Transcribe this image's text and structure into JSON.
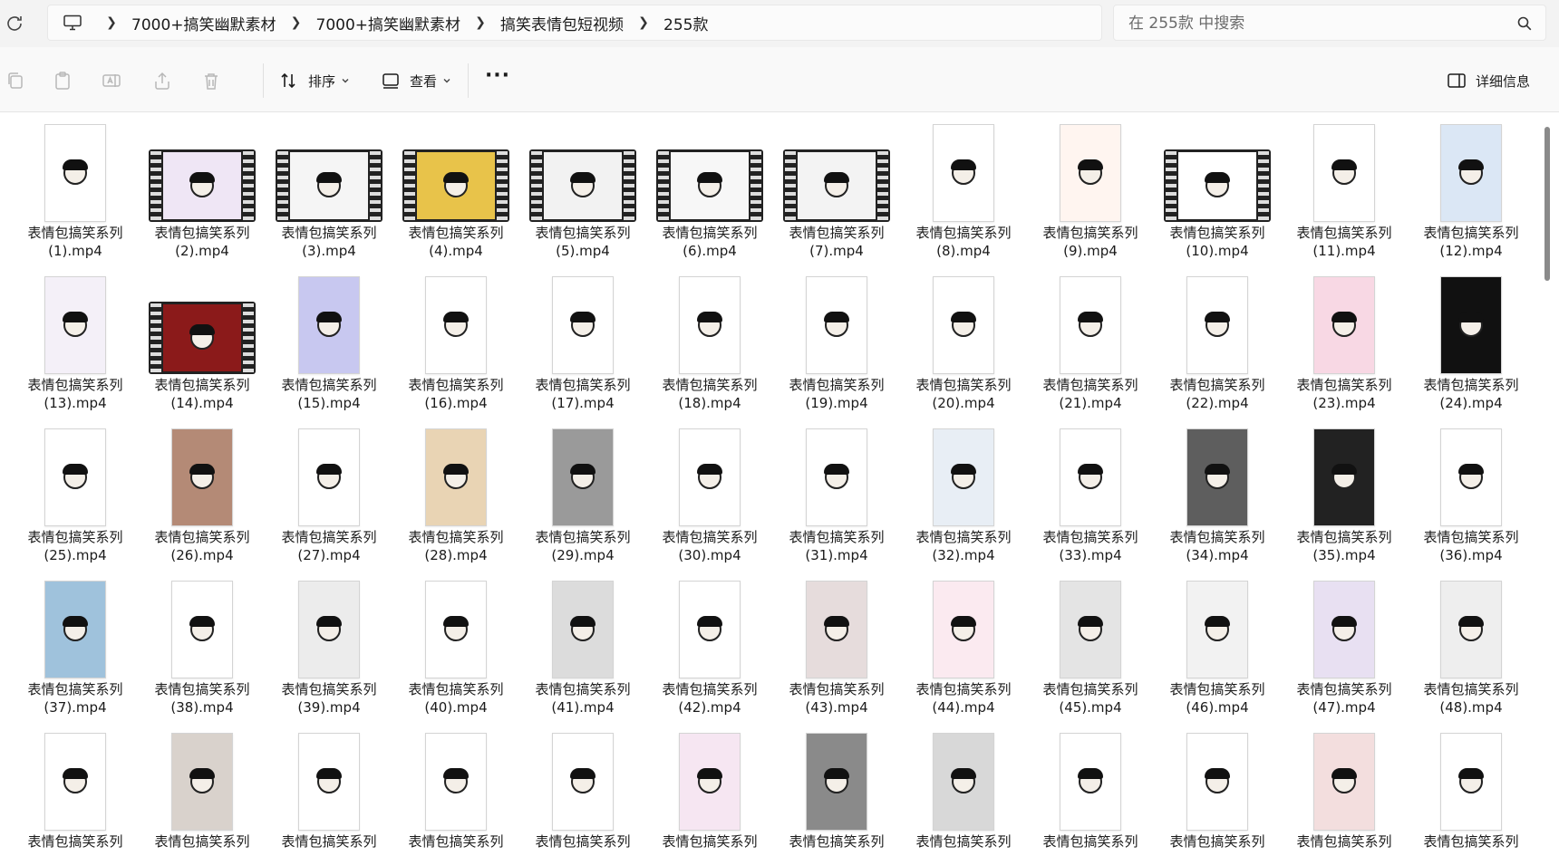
{
  "address": {
    "breadcrumbs": [
      "7000+搞笑幽默素材",
      "7000+搞笑幽默素材",
      "搞笑表情包短视频",
      "255款"
    ]
  },
  "search": {
    "placeholder": "在 255款 中搜索"
  },
  "toolbar": {
    "sort_label": "排序",
    "view_label": "查看",
    "more_label": "···",
    "details_label": "详细信息"
  },
  "files": [
    {
      "name": "表情包搞笑系列",
      "ext": "(1).mp4",
      "thumb": "portrait",
      "bg": "#ffffff"
    },
    {
      "name": "表情包搞笑系列",
      "ext": "(2).mp4",
      "thumb": "film",
      "bg": "#efe6f5"
    },
    {
      "name": "表情包搞笑系列",
      "ext": "(3).mp4",
      "thumb": "film",
      "bg": "#f5f5f5"
    },
    {
      "name": "表情包搞笑系列",
      "ext": "(4).mp4",
      "thumb": "film",
      "bg": "#e8c34a"
    },
    {
      "name": "表情包搞笑系列",
      "ext": "(5).mp4",
      "thumb": "film",
      "bg": "#f2f2f2"
    },
    {
      "name": "表情包搞笑系列",
      "ext": "(6).mp4",
      "thumb": "film",
      "bg": "#f7f7f7"
    },
    {
      "name": "表情包搞笑系列",
      "ext": "(7).mp4",
      "thumb": "film",
      "bg": "#f3f3f3"
    },
    {
      "name": "表情包搞笑系列",
      "ext": "(8).mp4",
      "thumb": "portrait",
      "bg": "#ffffff"
    },
    {
      "name": "表情包搞笑系列",
      "ext": "(9).mp4",
      "thumb": "portrait",
      "bg": "#fff5f0"
    },
    {
      "name": "表情包搞笑系列",
      "ext": "(10).mp4",
      "thumb": "film",
      "bg": "#ffffff"
    },
    {
      "name": "表情包搞笑系列",
      "ext": "(11).mp4",
      "thumb": "portrait",
      "bg": "#ffffff"
    },
    {
      "name": "表情包搞笑系列",
      "ext": "(12).mp4",
      "thumb": "portrait",
      "bg": "#dbe7f5"
    },
    {
      "name": "表情包搞笑系列",
      "ext": "(13).mp4",
      "thumb": "portrait",
      "bg": "#f4f0f8"
    },
    {
      "name": "表情包搞笑系列",
      "ext": "(14).mp4",
      "thumb": "film",
      "bg": "#8b1a1a"
    },
    {
      "name": "表情包搞笑系列",
      "ext": "(15).mp4",
      "thumb": "portrait",
      "bg": "#c8c8f0"
    },
    {
      "name": "表情包搞笑系列",
      "ext": "(16).mp4",
      "thumb": "portrait",
      "bg": "#ffffff"
    },
    {
      "name": "表情包搞笑系列",
      "ext": "(17).mp4",
      "thumb": "portrait",
      "bg": "#ffffff"
    },
    {
      "name": "表情包搞笑系列",
      "ext": "(18).mp4",
      "thumb": "portrait",
      "bg": "#ffffff"
    },
    {
      "name": "表情包搞笑系列",
      "ext": "(19).mp4",
      "thumb": "portrait",
      "bg": "#ffffff"
    },
    {
      "name": "表情包搞笑系列",
      "ext": "(20).mp4",
      "thumb": "portrait",
      "bg": "#ffffff"
    },
    {
      "name": "表情包搞笑系列",
      "ext": "(21).mp4",
      "thumb": "portrait",
      "bg": "#ffffff"
    },
    {
      "name": "表情包搞笑系列",
      "ext": "(22).mp4",
      "thumb": "portrait",
      "bg": "#ffffff"
    },
    {
      "name": "表情包搞笑系列",
      "ext": "(23).mp4",
      "thumb": "portrait",
      "bg": "#f8d8e4"
    },
    {
      "name": "表情包搞笑系列",
      "ext": "(24).mp4",
      "thumb": "portrait",
      "bg": "#111111"
    },
    {
      "name": "表情包搞笑系列",
      "ext": "(25).mp4",
      "thumb": "portrait",
      "bg": "#ffffff"
    },
    {
      "name": "表情包搞笑系列",
      "ext": "(26).mp4",
      "thumb": "portrait",
      "bg": "#b48a76"
    },
    {
      "name": "表情包搞笑系列",
      "ext": "(27).mp4",
      "thumb": "portrait",
      "bg": "#ffffff"
    },
    {
      "name": "表情包搞笑系列",
      "ext": "(28).mp4",
      "thumb": "portrait",
      "bg": "#e9d4b4"
    },
    {
      "name": "表情包搞笑系列",
      "ext": "(29).mp4",
      "thumb": "portrait",
      "bg": "#9a9a9a"
    },
    {
      "name": "表情包搞笑系列",
      "ext": "(30).mp4",
      "thumb": "portrait",
      "bg": "#ffffff"
    },
    {
      "name": "表情包搞笑系列",
      "ext": "(31).mp4",
      "thumb": "portrait",
      "bg": "#ffffff"
    },
    {
      "name": "表情包搞笑系列",
      "ext": "(32).mp4",
      "thumb": "portrait",
      "bg": "#e8eef5"
    },
    {
      "name": "表情包搞笑系列",
      "ext": "(33).mp4",
      "thumb": "portrait",
      "bg": "#ffffff"
    },
    {
      "name": "表情包搞笑系列",
      "ext": "(34).mp4",
      "thumb": "portrait",
      "bg": "#5e5e5e"
    },
    {
      "name": "表情包搞笑系列",
      "ext": "(35).mp4",
      "thumb": "portrait",
      "bg": "#222222"
    },
    {
      "name": "表情包搞笑系列",
      "ext": "(36).mp4",
      "thumb": "portrait",
      "bg": "#ffffff"
    },
    {
      "name": "表情包搞笑系列",
      "ext": "(37).mp4",
      "thumb": "portrait",
      "bg": "#9fc2dc"
    },
    {
      "name": "表情包搞笑系列",
      "ext": "(38).mp4",
      "thumb": "portrait",
      "bg": "#ffffff"
    },
    {
      "name": "表情包搞笑系列",
      "ext": "(39).mp4",
      "thumb": "portrait",
      "bg": "#ececec"
    },
    {
      "name": "表情包搞笑系列",
      "ext": "(40).mp4",
      "thumb": "portrait",
      "bg": "#ffffff"
    },
    {
      "name": "表情包搞笑系列",
      "ext": "(41).mp4",
      "thumb": "portrait",
      "bg": "#dcdcdc"
    },
    {
      "name": "表情包搞笑系列",
      "ext": "(42).mp4",
      "thumb": "portrait",
      "bg": "#ffffff"
    },
    {
      "name": "表情包搞笑系列",
      "ext": "(43).mp4",
      "thumb": "portrait",
      "bg": "#e6dcdc"
    },
    {
      "name": "表情包搞笑系列",
      "ext": "(44).mp4",
      "thumb": "portrait",
      "bg": "#fbeaf0"
    },
    {
      "name": "表情包搞笑系列",
      "ext": "(45).mp4",
      "thumb": "portrait",
      "bg": "#e4e4e4"
    },
    {
      "name": "表情包搞笑系列",
      "ext": "(46).mp4",
      "thumb": "portrait",
      "bg": "#f2f2f2"
    },
    {
      "name": "表情包搞笑系列",
      "ext": "(47).mp4",
      "thumb": "portrait",
      "bg": "#e8e0f2"
    },
    {
      "name": "表情包搞笑系列",
      "ext": "(48).mp4",
      "thumb": "portrait",
      "bg": "#eeeeee"
    },
    {
      "name": "表情包搞笑系列",
      "ext": "",
      "thumb": "portrait",
      "bg": "#ffffff"
    },
    {
      "name": "表情包搞笑系列",
      "ext": "",
      "thumb": "portrait",
      "bg": "#d9d2cc"
    },
    {
      "name": "表情包搞笑系列",
      "ext": "",
      "thumb": "portrait",
      "bg": "#ffffff"
    },
    {
      "name": "表情包搞笑系列",
      "ext": "",
      "thumb": "portrait",
      "bg": "#ffffff"
    },
    {
      "name": "表情包搞笑系列",
      "ext": "",
      "thumb": "portrait",
      "bg": "#ffffff"
    },
    {
      "name": "表情包搞笑系列",
      "ext": "",
      "thumb": "portrait",
      "bg": "#f6e6f2"
    },
    {
      "name": "表情包搞笑系列",
      "ext": "",
      "thumb": "portrait",
      "bg": "#8a8a8a"
    },
    {
      "name": "表情包搞笑系列",
      "ext": "",
      "thumb": "portrait",
      "bg": "#d8d8d8"
    },
    {
      "name": "表情包搞笑系列",
      "ext": "",
      "thumb": "portrait",
      "bg": "#ffffff"
    },
    {
      "name": "表情包搞笑系列",
      "ext": "",
      "thumb": "portrait",
      "bg": "#ffffff"
    },
    {
      "name": "表情包搞笑系列",
      "ext": "",
      "thumb": "portrait",
      "bg": "#f3dede"
    },
    {
      "name": "表情包搞笑系列",
      "ext": "",
      "thumb": "portrait",
      "bg": "#ffffff"
    }
  ]
}
